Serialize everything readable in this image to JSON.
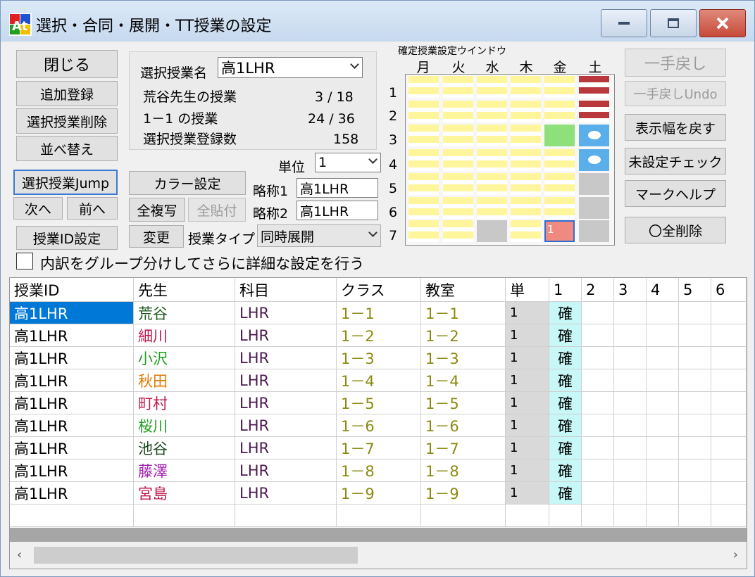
{
  "window": {
    "title": "選択・合同・展開・TT授業の設定"
  },
  "left_buttons": {
    "close": "閉じる",
    "add": "追加登録",
    "delete": "選択授業削除",
    "sort": "並べ替え",
    "jump": "選択授業Jump",
    "next": "次へ",
    "prev": "前へ",
    "id_setting": "授業ID設定"
  },
  "selection": {
    "label": "選択授業名",
    "value": "高1LHR",
    "teacher_label": "荒谷先生の授業",
    "teacher_count": "3 / 18",
    "class_label": "1－1 の授業",
    "class_count": "24 / 36",
    "reg_label": "選択授業登録数",
    "reg_count": "158"
  },
  "mid_controls": {
    "unit_label": "単位",
    "unit_value": "1",
    "color_button": "カラー設定",
    "copy_all": "全複写",
    "paste_all": "全貼付",
    "change": "変更",
    "abbr1_label": "略称1",
    "abbr1_value": "高1LHR",
    "abbr2_label": "略称2",
    "abbr2_value": "高1LHR",
    "type_label": "授業タイプ",
    "type_value": "同時展開"
  },
  "timetable": {
    "title": "確定授業設定ウインドウ",
    "days": [
      "月",
      "火",
      "水",
      "木",
      "金",
      "土"
    ],
    "periods": [
      "1",
      "2",
      "3",
      "4",
      "5",
      "6",
      "7"
    ],
    "selected_cell_text": "1"
  },
  "right_buttons": {
    "undo": "一手戻し",
    "undo_en": "一手戻しUndo",
    "reset_width": "表示幅を戻す",
    "check_unset": "未設定チェック",
    "mark_help": "マークヘルプ",
    "delete_all": "〇全削除"
  },
  "detail_checkbox": "内訳をグループ分けしてさらに詳細な設定を行う",
  "table": {
    "headers": [
      "授業ID",
      "先生",
      "科目",
      "クラス",
      "教室",
      "単",
      "1",
      "2",
      "3",
      "4",
      "5",
      "6"
    ],
    "rows": [
      {
        "id": "高1LHR",
        "teacher": "荒谷",
        "subject": "LHR",
        "klass": "1－1",
        "room": "1－1",
        "unit": "1",
        "p1": "確"
      },
      {
        "id": "高1LHR",
        "teacher": "細川",
        "subject": "LHR",
        "klass": "1－2",
        "room": "1－2",
        "unit": "1",
        "p1": "確"
      },
      {
        "id": "高1LHR",
        "teacher": "小沢",
        "subject": "LHR",
        "klass": "1－3",
        "room": "1－3",
        "unit": "1",
        "p1": "確"
      },
      {
        "id": "高1LHR",
        "teacher": "秋田",
        "subject": "LHR",
        "klass": "1－4",
        "room": "1－4",
        "unit": "1",
        "p1": "確"
      },
      {
        "id": "高1LHR",
        "teacher": "町村",
        "subject": "LHR",
        "klass": "1－5",
        "room": "1－5",
        "unit": "1",
        "p1": "確"
      },
      {
        "id": "高1LHR",
        "teacher": "桜川",
        "subject": "LHR",
        "klass": "1－6",
        "room": "1－6",
        "unit": "1",
        "p1": "確"
      },
      {
        "id": "高1LHR",
        "teacher": "池谷",
        "subject": "LHR",
        "klass": "1－7",
        "room": "1－7",
        "unit": "1",
        "p1": "確"
      },
      {
        "id": "高1LHR",
        "teacher": "藤澤",
        "subject": "LHR",
        "klass": "1－8",
        "room": "1－8",
        "unit": "1",
        "p1": "確"
      },
      {
        "id": "高1LHR",
        "teacher": "宮島",
        "subject": "LHR",
        "klass": "1－9",
        "room": "1－9",
        "unit": "1",
        "p1": "確"
      }
    ],
    "teacher_colors": [
      "#1e5a1e",
      "#c0194b",
      "#1ea01e",
      "#e07a00",
      "#c0194b",
      "#1ea01e",
      "#1e4a1e",
      "#a020b0",
      "#c0194b"
    ]
  },
  "colors": {
    "selection_blue": "#0078d7",
    "cell_yellow": "#fff59a",
    "cell_green": "#8ee07a",
    "cell_blue": "#5aaeea",
    "cell_red": "#b8383b",
    "cell_gray": "#c8c8c8",
    "confirm_cyan": "#c7f7f7",
    "unit_gray": "#d9d9d9"
  }
}
